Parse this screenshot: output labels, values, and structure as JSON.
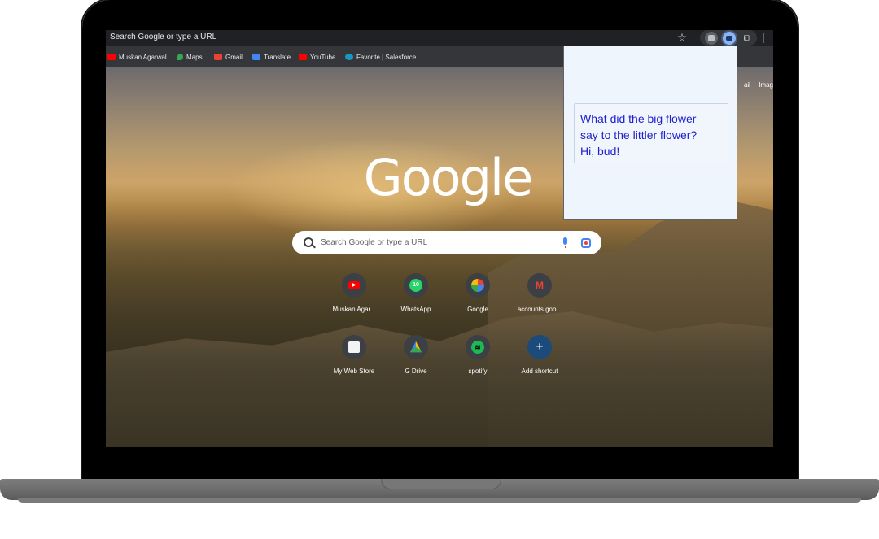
{
  "browser": {
    "address_text": "Search Google or type a URL",
    "top_links": [
      "ail",
      "Imag"
    ]
  },
  "bookmarks": [
    {
      "label": "Muskan Agarwal",
      "icon": "youtube-icon",
      "color": "#ff0000"
    },
    {
      "label": "Maps",
      "icon": "maps-icon",
      "color": "#34a853"
    },
    {
      "label": "Gmail",
      "icon": "gmail-icon",
      "color": "#ea4335"
    },
    {
      "label": "Translate",
      "icon": "translate-icon",
      "color": "#4285f4"
    },
    {
      "label": "YouTube",
      "icon": "youtube-icon",
      "color": "#ff0000"
    },
    {
      "label": "Favorite | Salesforce",
      "icon": "salesforce-icon",
      "color": "#1798c1"
    }
  ],
  "ntp": {
    "logo": "Google",
    "search_placeholder": "Search Google or type a URL",
    "shortcuts": [
      {
        "label": "Muskan Agar...",
        "icon": "youtube-icon",
        "color": "#ff0000"
      },
      {
        "label": "WhatsApp",
        "icon": "whatsapp-icon",
        "color": "#25d366"
      },
      {
        "label": "Google",
        "icon": "google-icon",
        "color": "#4285f4"
      },
      {
        "label": "accounts.goo...",
        "icon": "gmail-icon",
        "color": "#ea4335"
      },
      {
        "label": "My Web Store",
        "icon": "webstore-icon",
        "color": "#db4437"
      },
      {
        "label": "G Drive",
        "icon": "drive-icon",
        "color": "#fbbc04"
      },
      {
        "label": "spotify",
        "icon": "spotify-icon",
        "color": "#1db954"
      },
      {
        "label": "Add shortcut",
        "icon": "plus-icon",
        "color": "#1a4b7a"
      }
    ]
  },
  "popup": {
    "joke_lines": [
      "What did the big flower",
      "say to the littler flower?",
      "Hi, bud!"
    ]
  }
}
